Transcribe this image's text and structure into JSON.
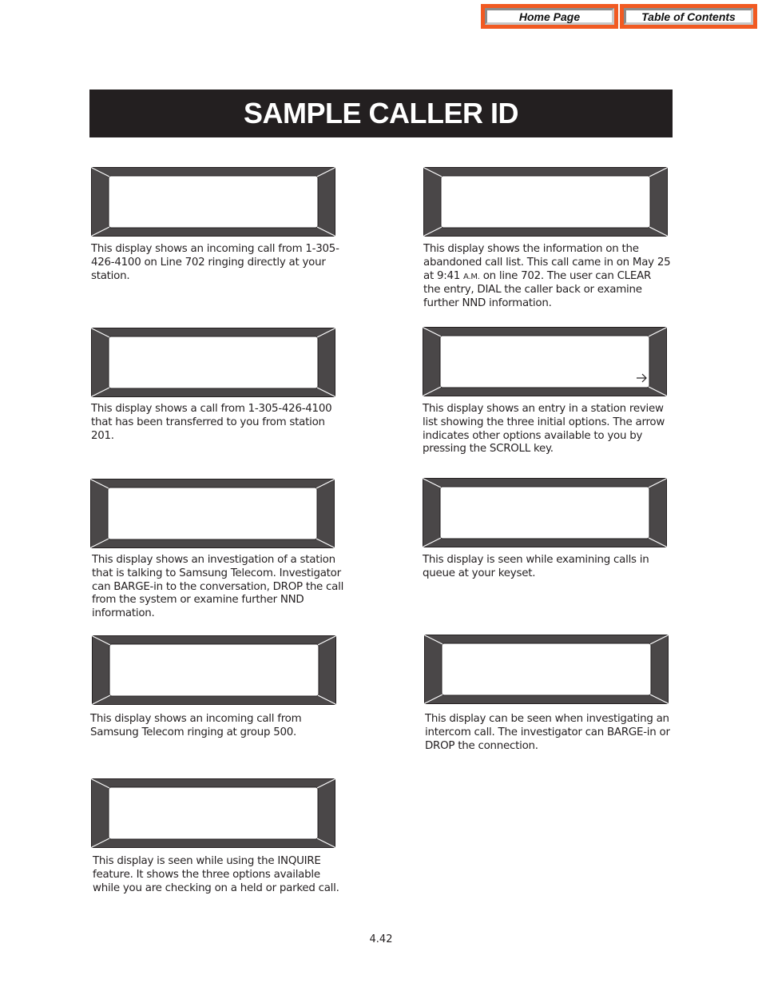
{
  "nav": {
    "home_label": "Home Page",
    "toc_label": "Table of Contents"
  },
  "title": "SAMPLE CALLER ID",
  "displays": [
    {
      "id": "incoming-call-line-702",
      "arrow": false,
      "caption": "This display shows an incoming call from 1-305-426-4100 on Line 702 ringing directly at your station."
    },
    {
      "id": "abandoned-call-list",
      "arrow": false,
      "caption_parts": [
        "This display shows the information on the abandoned call list. This call came in on May 25 at 9:41 ",
        "A.M.",
        " on line 702. The user can CLEAR the entry, DIAL the caller back or examine further NND information."
      ]
    },
    {
      "id": "transferred-call",
      "arrow": false,
      "caption": "This display shows a call from 1-305-426-4100 that has been transferred to you from station 201."
    },
    {
      "id": "station-review-list",
      "arrow": true,
      "arrow_icon": "right-arrow",
      "caption": "This display shows an entry in a station review list showing the three initial options. The arrow indicates other options available to you by pressing the SCROLL key."
    },
    {
      "id": "investigation-station",
      "arrow": false,
      "caption": "This display shows an investigation of a station that is talking to Samsung Telecom. Investigator can BARGE-in to the conversation, DROP the call from the system or examine further NND information."
    },
    {
      "id": "calls-in-queue",
      "arrow": false,
      "caption": "This display is seen while examining calls in queue at your keyset."
    },
    {
      "id": "incoming-call-group-500",
      "arrow": false,
      "caption": "This display shows an incoming call from Samsung Telecom ringing at group 500."
    },
    {
      "id": "investigating-intercom",
      "arrow": false,
      "caption": "This display can be seen when investigating an intercom call. The investigator can BARGE-in or DROP the connection."
    },
    {
      "id": "inquire-feature",
      "arrow": false,
      "caption": "This display is seen while using the INQUIRE feature. It shows the three options available while you are checking on a held or parked call."
    }
  ],
  "page_number": "4.42",
  "colors": {
    "nav_border": "#f15a22",
    "banner_bg": "#231f20",
    "bezel": "#4a4748",
    "text": "#231f20"
  }
}
